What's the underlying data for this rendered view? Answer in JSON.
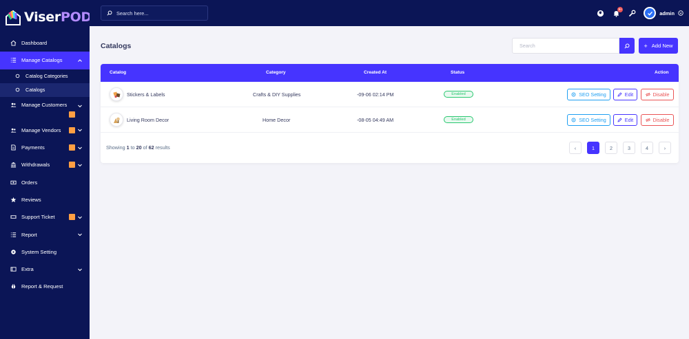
{
  "brand": {
    "name_a": "Viser",
    "name_b": "POD"
  },
  "sidebar": {
    "dashboard": "Dashboard",
    "manage_catalogs": "Manage Catalogs",
    "catalog_categories": "Catalog Categories",
    "catalogs": "Catalogs",
    "manage_customers": "Manage Customers",
    "manage_vendors": "Manage Vendors",
    "payments": "Payments",
    "withdrawals": "Withdrawals",
    "orders": "Orders",
    "reviews": "Reviews",
    "support_ticket": "Support Ticket",
    "report": "Report",
    "system_setting": "System Setting",
    "extra": "Extra",
    "report_request": "Report & Request"
  },
  "topbar": {
    "search_placeholder": "Search here...",
    "notification_count": "9+",
    "user": "admin"
  },
  "page": {
    "title": "Catalogs",
    "search_placeholder": "Search",
    "add_new": "Add New"
  },
  "table": {
    "headers": {
      "catalog": "Catalog",
      "category": "Category",
      "created_at": "Created At",
      "status": "Status",
      "action": "Action"
    },
    "rows": [
      {
        "catalog": "Stickers & Labels",
        "category": "Crafts & DIY Supplies",
        "created_at": "-09-06 02:14 PM",
        "status": "Enabled"
      },
      {
        "catalog": "Living Room Decor",
        "category": "Home Decor",
        "created_at": "-08-05 04:49 AM",
        "status": "Enabled"
      }
    ],
    "actions": {
      "seo": "SEO Setting",
      "edit": "Edit",
      "disable": "Disable"
    }
  },
  "pagination": {
    "from": "1",
    "to": "20",
    "total": "62",
    "showing": "Showing",
    "to_word": "to",
    "of_word": "of",
    "results": "results",
    "prev": "‹",
    "next": "›",
    "pages": [
      "1",
      "2",
      "3",
      "4"
    ]
  },
  "colors": {
    "sidebar_bg": "#0b1556",
    "accent": "#4634ff",
    "badge": "#ff9f43",
    "success": "#28c76f",
    "danger": "#ea5455",
    "info": "#1e9ff2"
  }
}
